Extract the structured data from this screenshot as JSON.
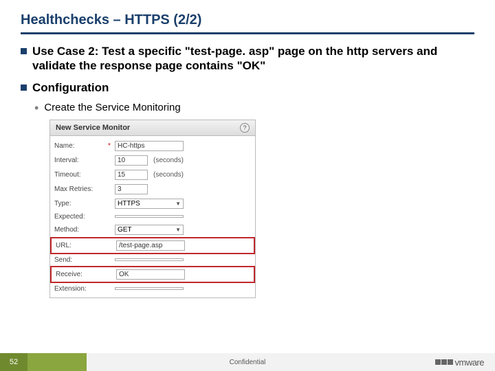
{
  "title": "Healthchecks – HTTPS (2/2)",
  "bullets": {
    "usecase": "Use Case 2: Test a specific \"test-page. asp\" page on the http servers and validate the response page contains \"OK\"",
    "config": "Configuration",
    "sub": "Create the Service Monitoring"
  },
  "dialog": {
    "header": "New Service Monitor",
    "help": "?",
    "fields": {
      "name": {
        "label": "Name:",
        "value": "HC-https",
        "required": true
      },
      "interval": {
        "label": "Interval:",
        "value": "10",
        "unit": "(seconds)"
      },
      "timeout": {
        "label": "Timeout:",
        "value": "15",
        "unit": "(seconds)"
      },
      "maxretries": {
        "label": "Max Retries:",
        "value": "3"
      },
      "type": {
        "label": "Type:",
        "value": "HTTPS"
      },
      "expected": {
        "label": "Expected:",
        "value": ""
      },
      "method": {
        "label": "Method:",
        "value": "GET"
      },
      "url": {
        "label": "URL:",
        "value": "/test-page.asp"
      },
      "send": {
        "label": "Send:",
        "value": ""
      },
      "receive": {
        "label": "Receive:",
        "value": "OK"
      },
      "extension": {
        "label": "Extension:",
        "value": ""
      }
    }
  },
  "footer": {
    "page": "52",
    "confidential": "Confidential",
    "brand": "vmware"
  }
}
